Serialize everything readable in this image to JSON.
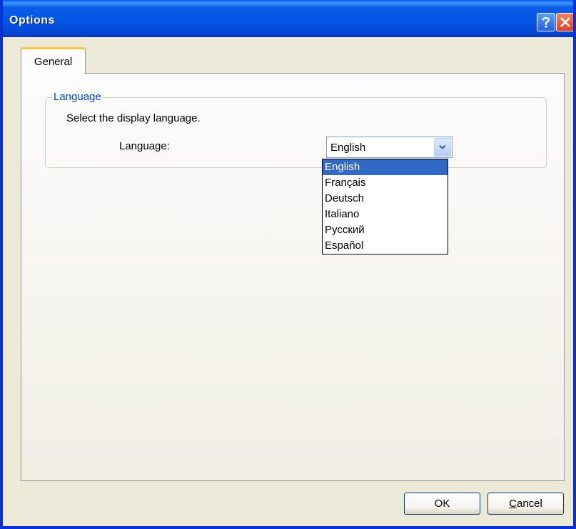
{
  "window": {
    "title": "Options"
  },
  "tabs": [
    {
      "label": "General",
      "active": true
    }
  ],
  "language_group": {
    "legend": "Language",
    "description": "Select the display language.",
    "field_label": "Language:",
    "selected_value": "English",
    "options": [
      "English",
      "Français",
      "Deutsch",
      "Italiano",
      "Русский",
      "Español"
    ],
    "highlighted_index": 0
  },
  "buttons": {
    "ok_label": "OK",
    "cancel_label": "Cancel",
    "cancel_mnemonic": "C",
    "cancel_rest": "ancel"
  },
  "icons": {
    "help": "help-icon",
    "close": "close-icon",
    "dropdown": "chevron-down-icon"
  },
  "colors": {
    "title_bar": "#0355e6",
    "legend_text": "#0046d5",
    "selection": "#316ac5",
    "active_tab_accent": "#ffc83c"
  }
}
